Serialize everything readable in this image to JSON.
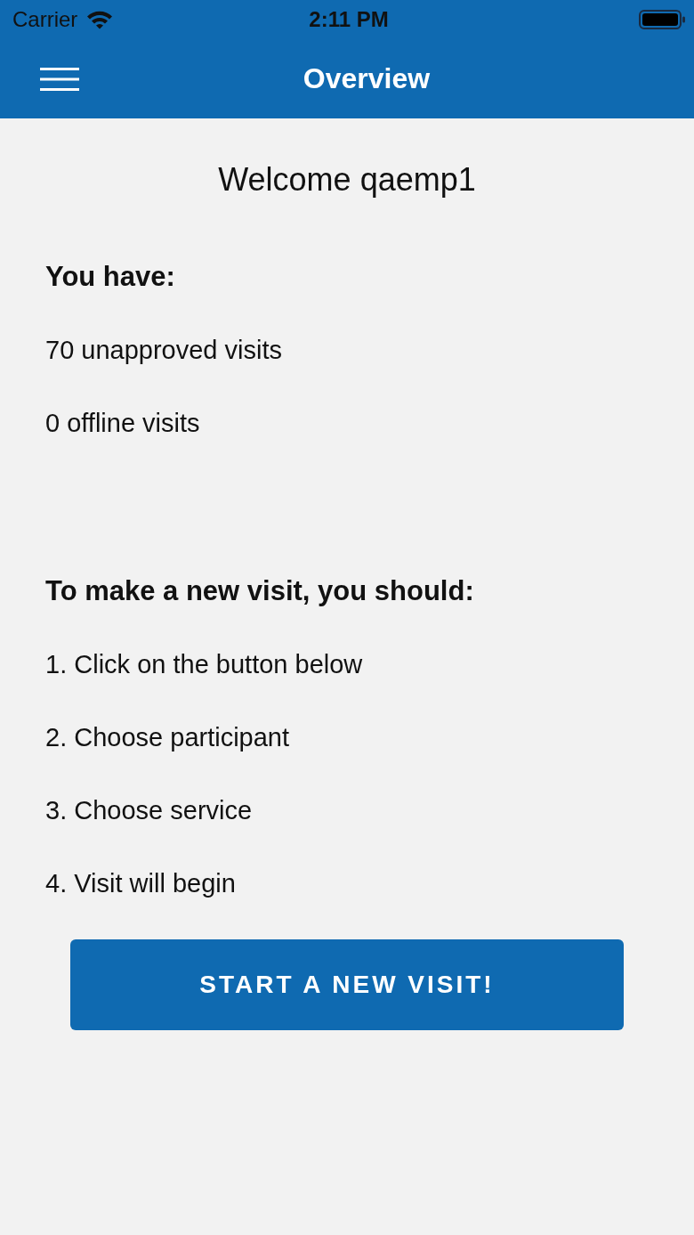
{
  "status_bar": {
    "carrier": "Carrier",
    "time": "2:11 PM"
  },
  "nav_bar": {
    "title": "Overview"
  },
  "welcome": "Welcome qaemp1",
  "summary": {
    "heading": "You have:",
    "items": [
      "70 unapproved visits",
      "0 offline visits"
    ]
  },
  "instructions": {
    "heading": "To make a new visit, you should:",
    "steps": [
      "1. Click on the button below",
      "2. Choose participant",
      "3. Choose service",
      "4. Visit will begin"
    ]
  },
  "primary_button": {
    "label": "START A NEW VISIT!"
  }
}
